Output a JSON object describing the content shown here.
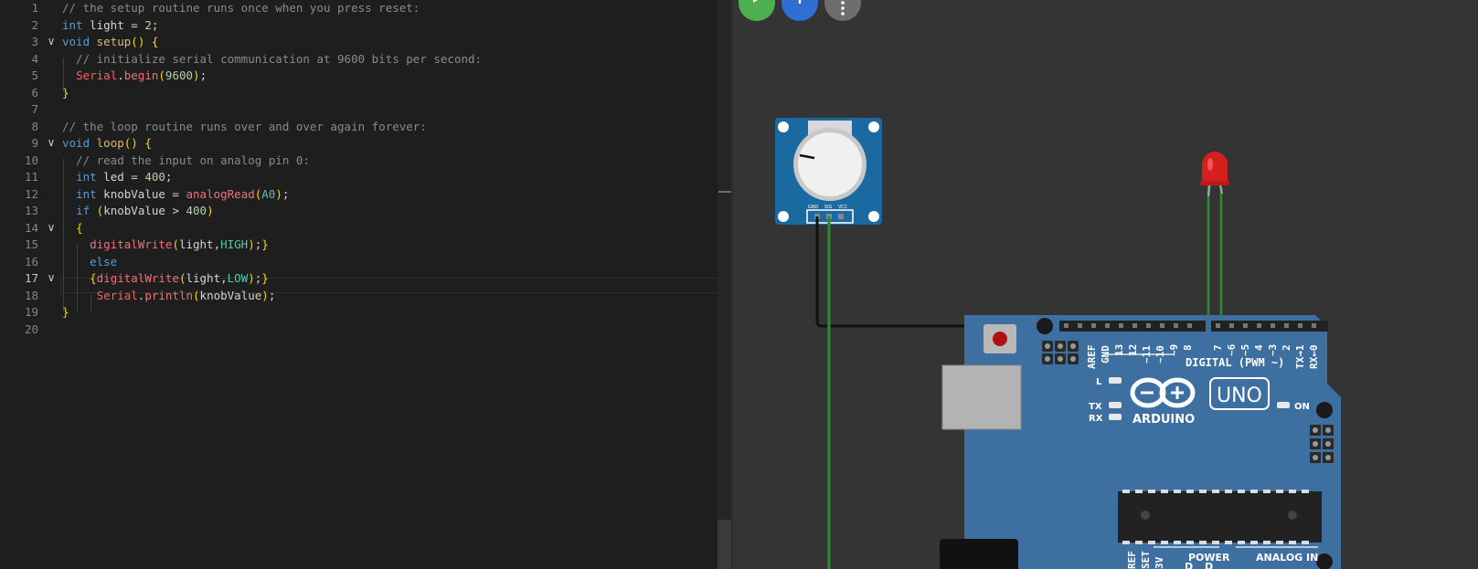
{
  "editor": {
    "active_line": "17",
    "lines": [
      {
        "num": "1",
        "text": "// the setup routine runs once when you press reset:"
      },
      {
        "num": "2",
        "text": "int light = 2;"
      },
      {
        "num": "3",
        "text": "void setup() {"
      },
      {
        "num": "4",
        "text": "  // initialize serial communication at 9600 bits per second:"
      },
      {
        "num": "5",
        "text": "  Serial.begin(9600);"
      },
      {
        "num": "6",
        "text": "}"
      },
      {
        "num": "7",
        "text": ""
      },
      {
        "num": "8",
        "text": "// the loop routine runs over and over again forever:"
      },
      {
        "num": "9",
        "text": "void loop() {"
      },
      {
        "num": "10",
        "text": "  // read the input on analog pin 0:"
      },
      {
        "num": "11",
        "text": "  int led = 400;"
      },
      {
        "num": "12",
        "text": "  int knobValue = analogRead(A0);"
      },
      {
        "num": "13",
        "text": "  if (knobValue > 400)"
      },
      {
        "num": "14",
        "text": "  {"
      },
      {
        "num": "15",
        "text": "    digitalWrite(light,HIGH);}"
      },
      {
        "num": "16",
        "text": "    else"
      },
      {
        "num": "17",
        "text": "    {digitalWrite(light,LOW);}"
      },
      {
        "num": "18",
        "text": "     Serial.println(knobValue);"
      },
      {
        "num": "19",
        "text": "}"
      },
      {
        "num": "20",
        "text": ""
      }
    ]
  },
  "toolbar": {
    "buttons": [
      {
        "name": "start-simulation-button",
        "icon": "play-icon",
        "color": "#4caf50"
      },
      {
        "name": "add-component-button",
        "icon": "plus-icon",
        "color": "#2e6fd1"
      },
      {
        "name": "more-options-button",
        "icon": "more-vertical-icon",
        "color": "#6e6e6e"
      }
    ]
  },
  "circuit": {
    "potentiometer_pins": [
      "GND",
      "SIG",
      "VCC"
    ],
    "board": {
      "model": "UNO",
      "brand": "ARDUINO",
      "digital_header_label": "DIGITAL (PWM ~)",
      "digital_pins": [
        "AREF",
        "GND",
        "13",
        "12",
        "~11",
        "~10",
        "~9",
        "8",
        "7",
        "~6",
        "~5",
        "4",
        "~3",
        "2",
        "TX→1",
        "RX←0"
      ],
      "led_labels": {
        "l": "L",
        "tx": "TX",
        "rx": "RX",
        "on": "ON"
      },
      "power_labels": [
        "REF",
        "SET",
        "3V"
      ],
      "power_header": "POWER",
      "analog_header": "ANALOG IN"
    },
    "colors": {
      "board": "#3d6fa0",
      "wire_green": "#2e8b2e",
      "wire_black": "#111111",
      "led": "#d62020"
    }
  }
}
